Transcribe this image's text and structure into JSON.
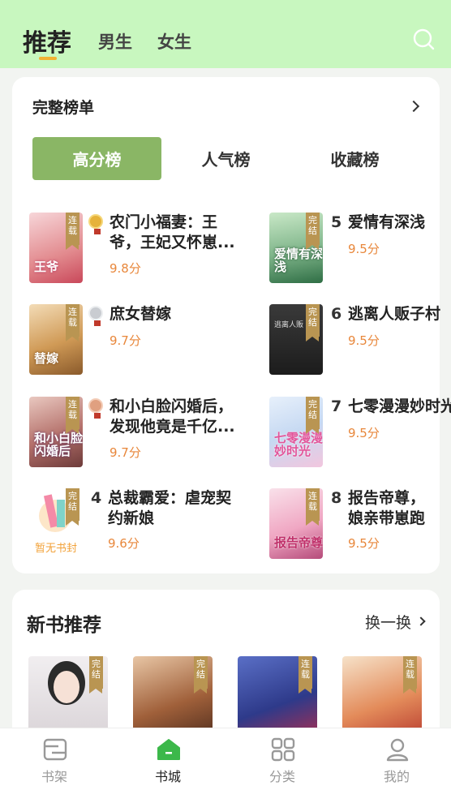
{
  "header": {
    "tabs": [
      {
        "label": "推荐",
        "active": true
      },
      {
        "label": "男生"
      },
      {
        "label": "女生"
      }
    ],
    "search_icon": "search-icon",
    "background": "#c8f7bf",
    "accent": "#f2b233"
  },
  "ranking": {
    "title": "完整榜单",
    "tabs": [
      {
        "label": "高分榜",
        "active": true
      },
      {
        "label": "人气榜"
      },
      {
        "label": "收藏榜"
      }
    ],
    "active_color": "#8ab665",
    "books": [
      {
        "rank": "1",
        "title": "农门小福妻：王爷，王妃又怀崽...",
        "score": "9.8分",
        "status": "连载",
        "cover_text": "王爷",
        "medal": "gold-medal-icon"
      },
      {
        "rank": "5",
        "title": "爱情有深浅",
        "score": "9.5分",
        "status": "完结",
        "cover_text": "爱情有深浅"
      },
      {
        "rank": "2",
        "title": "庶女替嫁",
        "score": "9.7分",
        "status": "连载",
        "cover_text": "替嫁",
        "medal": "silver-medal-icon"
      },
      {
        "rank": "6",
        "title": "逃离人贩子村",
        "score": "9.5分",
        "status": "完结",
        "cover_text": "逃离人贩"
      },
      {
        "rank": "3",
        "title": "和小白脸闪婚后，发现他竟是千亿...",
        "score": "9.7分",
        "status": "连载",
        "cover_text": "和小白脸闪婚后",
        "medal": "bronze-medal-icon"
      },
      {
        "rank": "7",
        "title": "七零漫漫妙时光",
        "score": "9.5分",
        "status": "完结",
        "cover_text": "七零漫漫妙时光"
      },
      {
        "rank": "4",
        "title": "总裁霸爱：虐宠契约新娘",
        "score": "9.6分",
        "status": "完结",
        "cover_text": "暂无书封"
      },
      {
        "rank": "8",
        "title": "报告帝尊，娘亲带崽跑路了!",
        "score": "9.5分",
        "status": "连载",
        "cover_text": "报告帝尊"
      }
    ]
  },
  "new_books": {
    "title": "新书推荐",
    "refresh_label": "换一换",
    "covers": [
      {
        "status": "完结"
      },
      {
        "status": "完结"
      },
      {
        "status": "连载"
      },
      {
        "status": "连载"
      }
    ]
  },
  "bottom_nav": [
    {
      "label": "书架",
      "icon": "bookshelf-icon"
    },
    {
      "label": "书城",
      "icon": "bookstore-icon",
      "active": true
    },
    {
      "label": "分类",
      "icon": "category-grid-icon"
    },
    {
      "label": "我的",
      "icon": "profile-icon"
    }
  ]
}
